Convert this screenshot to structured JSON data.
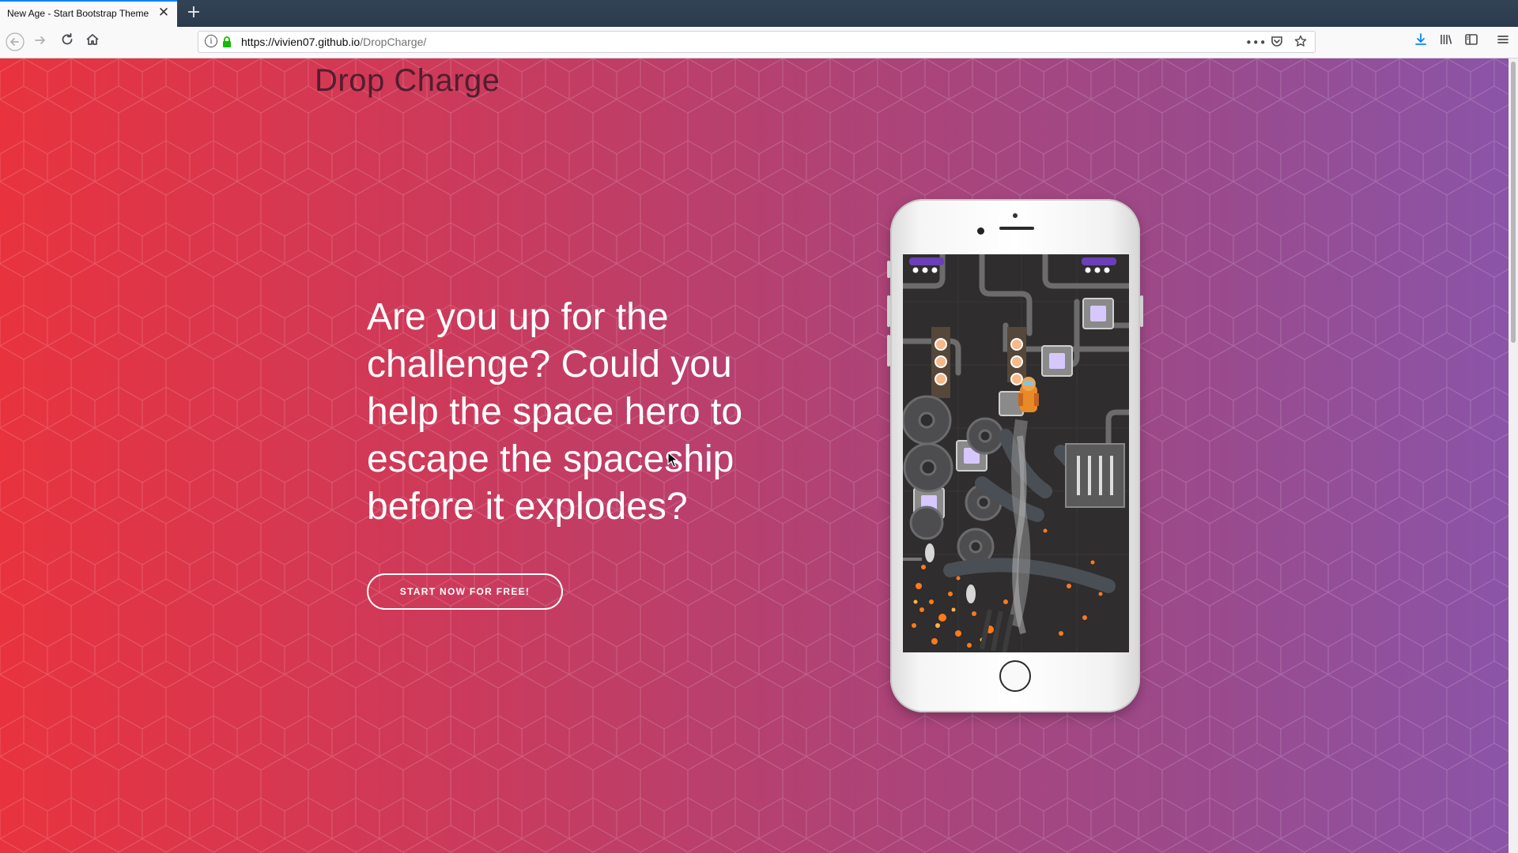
{
  "browser": {
    "tab_title": "New Age - Start Bootstrap Theme",
    "tab_close": "✕",
    "new_tab": "+",
    "url_host": "https://vivien07.github.io",
    "url_path": "/DropCharge/",
    "back_icon": "back-arrow-icon",
    "forward_icon": "forward-arrow-icon",
    "reload_icon": "reload-icon",
    "home_icon": "home-icon",
    "page_actions_icon": "more-dots-icon",
    "pocket_icon": "pocket-icon",
    "bookmark_icon": "star-icon",
    "download_icon": "download-arrow-icon",
    "library_icon": "library-icon",
    "sidebar_icon": "sidebar-icon",
    "menu_icon": "hamburger-menu-icon",
    "accent": "#0a84ff"
  },
  "page": {
    "brand": "Drop Charge",
    "headline": "Are you up for the challenge? Could you help the space hero to escape the spaceship before it explodes?",
    "cta_label": "START NOW FOR FREE!",
    "gradient_start": "#e8333e",
    "gradient_end": "#8b54a8"
  }
}
